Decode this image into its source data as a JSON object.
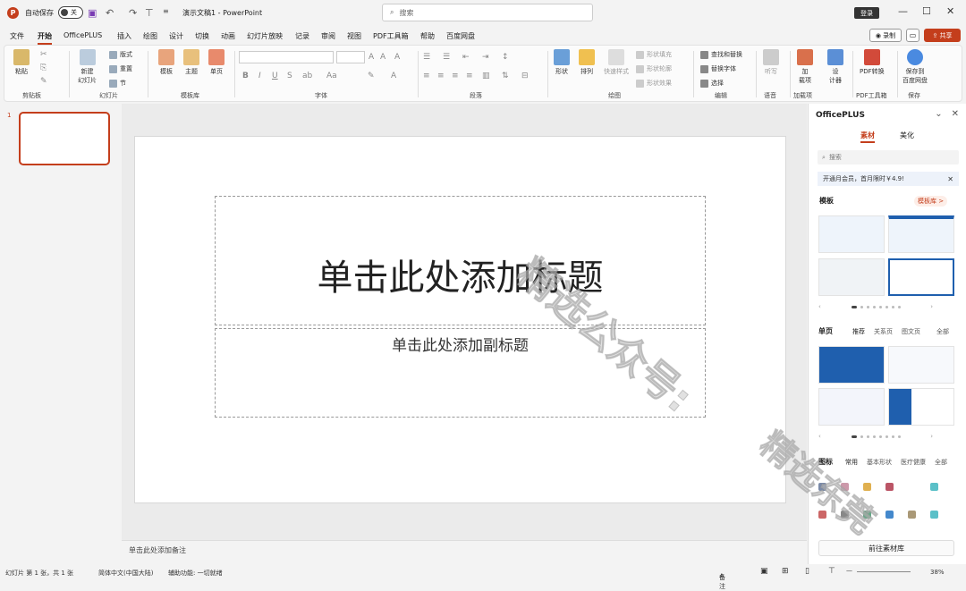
{
  "titlebar": {
    "logo_letter": "P",
    "autosave_label": "自动保存",
    "autosave_state": "关",
    "doc_title": "演示文稿1",
    "app_name": "PowerPoint",
    "search_placeholder": "搜索",
    "login_label": "登录"
  },
  "menu": {
    "tabs": [
      "文件",
      "开始",
      "OfficePLUS",
      "插入",
      "绘图",
      "设计",
      "切换",
      "动画",
      "幻灯片放映",
      "记录",
      "审阅",
      "视图",
      "PDF工具箱",
      "帮助",
      "百度网盘"
    ],
    "active_tab": "开始",
    "record_label": "录制",
    "share_label": "共享"
  },
  "ribbon": {
    "groups": [
      "剪贴板",
      "幻灯片",
      "模板库",
      "字体",
      "段落",
      "绘图",
      "编辑",
      "语音",
      "加载项",
      "PDF工具箱",
      "保存"
    ],
    "paste": "粘贴",
    "new_slide": "新建\n幻灯片",
    "layout": "版式",
    "reset": "重置",
    "section": "节",
    "template": "模板",
    "theme": "主题",
    "single_page": "单页",
    "shape": "形状",
    "arrange": "排列",
    "quick_style": "快速样式",
    "shape_fill": "形状填充",
    "shape_outline": "形状轮廓",
    "shape_effect": "形状效果",
    "find_replace": "查找和替换",
    "replace_font": "替换字体",
    "select": "选择",
    "dictate": "听写",
    "addins": "加\n载项",
    "designer": "设\n计器",
    "pdf_convert": "PDF转换",
    "save_baidu": "保存到\n百度网盘"
  },
  "slide": {
    "number": "1",
    "title_placeholder": "单击此处添加标题",
    "subtitle_placeholder": "单击此处添加副标题"
  },
  "notes_placeholder": "单击此处添加备注",
  "status": {
    "slide_count": "幻灯片 第 1 张，共 1 张",
    "language": "简体中文(中国大陆)",
    "accessibility": "辅助功能: 一切就绪",
    "notes": "备注",
    "zoom": "38%"
  },
  "panel": {
    "title": "OfficePLUS",
    "tabs": [
      "素材",
      "美化"
    ],
    "active_tab": "素材",
    "search_placeholder": "搜索",
    "promo": "开通月会员，首月限时￥4.9!",
    "section_templates": "模板",
    "templates_more": "模板库 >",
    "section_pages": "单页",
    "page_subtabs": [
      "推荐",
      "关系页",
      "图文页",
      "全部"
    ],
    "section_icons": "图标",
    "icon_subtabs": [
      "常用",
      "基本形状",
      "医疗健康",
      "全部"
    ],
    "footer_button": "前往素材库"
  },
  "watermark": [
    "精选公众号:",
    "精选东莞"
  ],
  "colors": {
    "accent": "#c43e1c",
    "ribbon_bg": "#fbfbfb",
    "panel_blue": "#1f5fae"
  }
}
